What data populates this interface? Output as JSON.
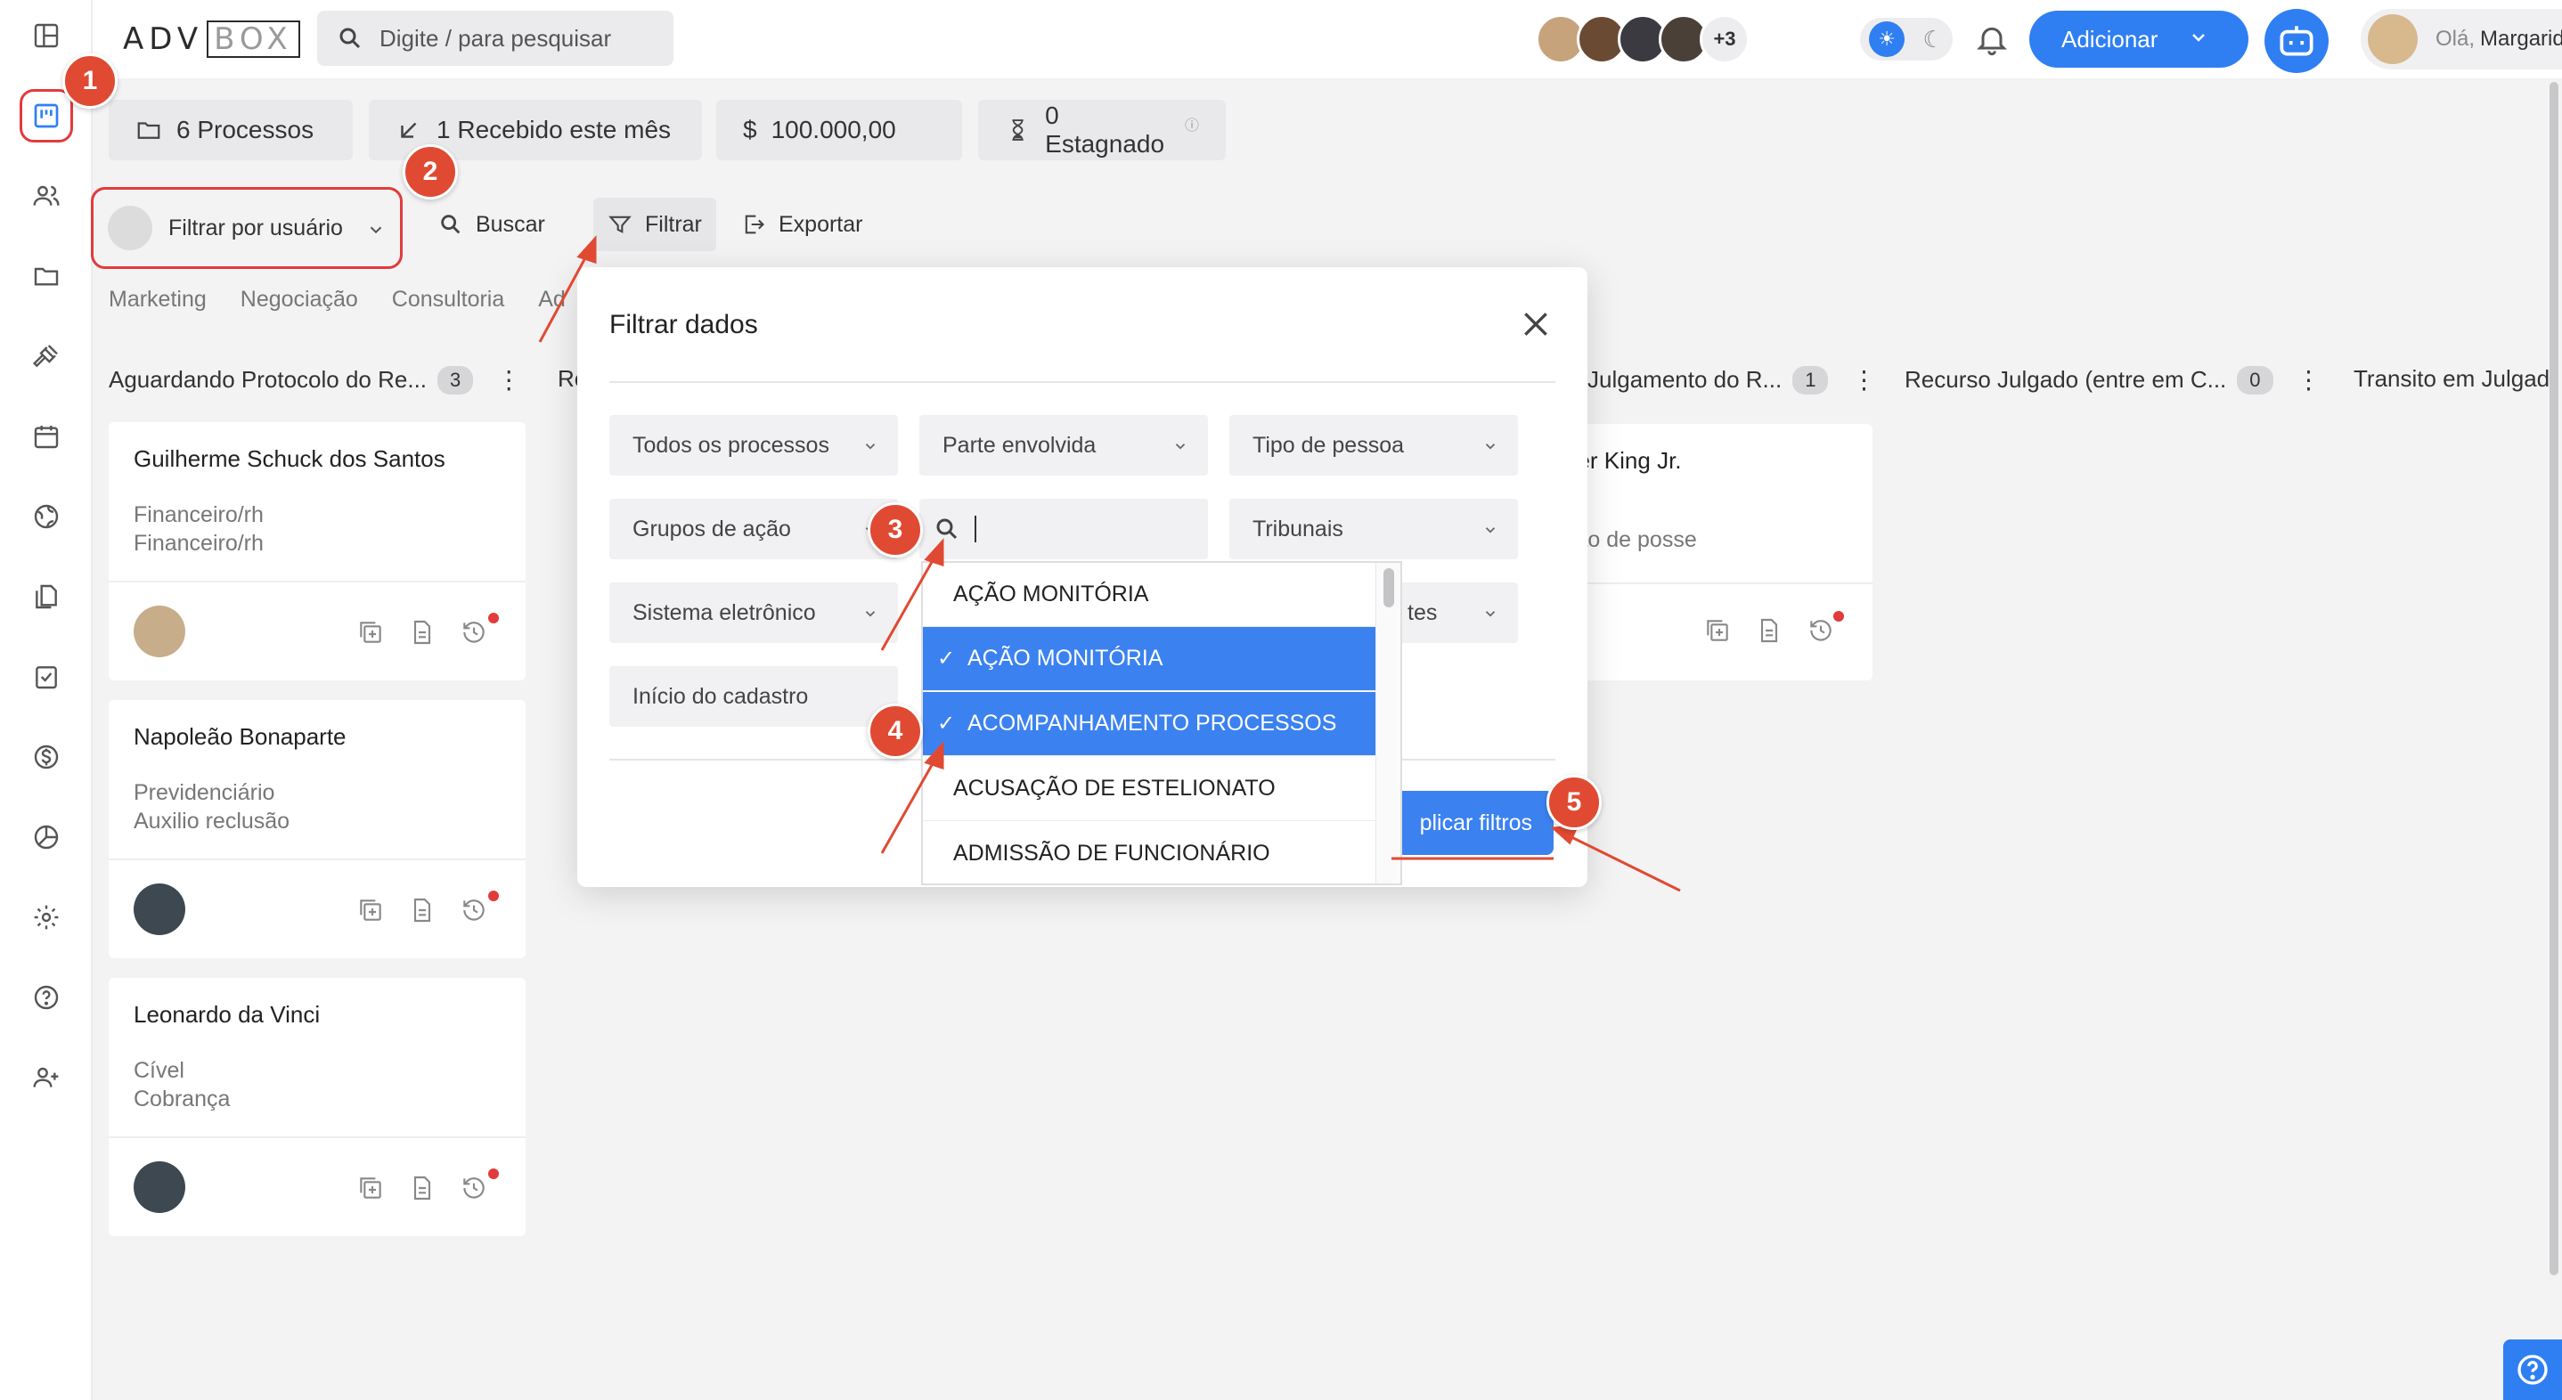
{
  "header": {
    "logo_left": "ADV",
    "logo_right": "BOX",
    "search_placeholder": "Digite / para pesquisar",
    "more_avatars": "+3",
    "add_button": "Adicionar",
    "greeting": "Olá,",
    "user_name": "Margarida"
  },
  "stats": {
    "processes": "6 Processos",
    "received": "1 Recebido este mês",
    "amount": "100.000,00",
    "stagnant": "0 Estagnado"
  },
  "toolbar": {
    "user_filter": "Filtrar por usuário",
    "search": "Buscar",
    "filter": "Filtrar",
    "export": "Exportar"
  },
  "tabs": [
    "Marketing",
    "Negociação",
    "Consultoria",
    "Ad"
  ],
  "columns": {
    "col1_title": "Aguardando Protocolo do Re...",
    "col1_count": "3",
    "col2_title": "Re",
    "col3_title": "Julgamento do R...",
    "col3_count": "1",
    "col4_title": "Recurso Julgado (entre em C...",
    "col4_count": "0",
    "col5_title": "Transito em Julgad"
  },
  "cards": [
    {
      "name": "Guilherme Schuck dos Santos",
      "line1": "Financeiro/rh",
      "line2": "Financeiro/rh"
    },
    {
      "name": "Napoleão Bonaparte",
      "line1": "Previdenciário",
      "line2": "Auxilio reclusão"
    },
    {
      "name": "Leonardo da Vinci",
      "line1": "Cível",
      "line2": "Cobrança"
    }
  ],
  "card_right": {
    "name": "her King Jr.",
    "line1": "ção de posse"
  },
  "modal": {
    "title": "Filtrar dados",
    "filters": {
      "all_processes": "Todos os processos",
      "party": "Parte envolvida",
      "person_type": "Tipo de pessoa",
      "action_groups": "Grupos de ação",
      "courts": "Tribunais",
      "electronic_system": "Sistema eletrônico",
      "partial_right": "tes",
      "registration_start": "Início do cadastro"
    },
    "dropdown_items": [
      {
        "label": "AÇÃO MONITÓRIA",
        "selected": false
      },
      {
        "label": "AÇÃO MONITÓRIA",
        "selected": true
      },
      {
        "label": "ACOMPANHAMENTO PROCESSOS",
        "selected": true
      },
      {
        "label": "ACUSAÇÃO DE ESTELIONATO",
        "selected": false
      },
      {
        "label": "ADMISSÃO DE FUNCIONÁRIO",
        "selected": false
      }
    ],
    "check_mark": "✓",
    "apply": "plicar filtros"
  },
  "markers": [
    "1",
    "2",
    "3",
    "4",
    "5"
  ],
  "colors": {
    "accent": "#2f7ff2",
    "selected": "#3b82f0",
    "marker": "#e04a32",
    "highlight_border": "#e23b3b"
  }
}
